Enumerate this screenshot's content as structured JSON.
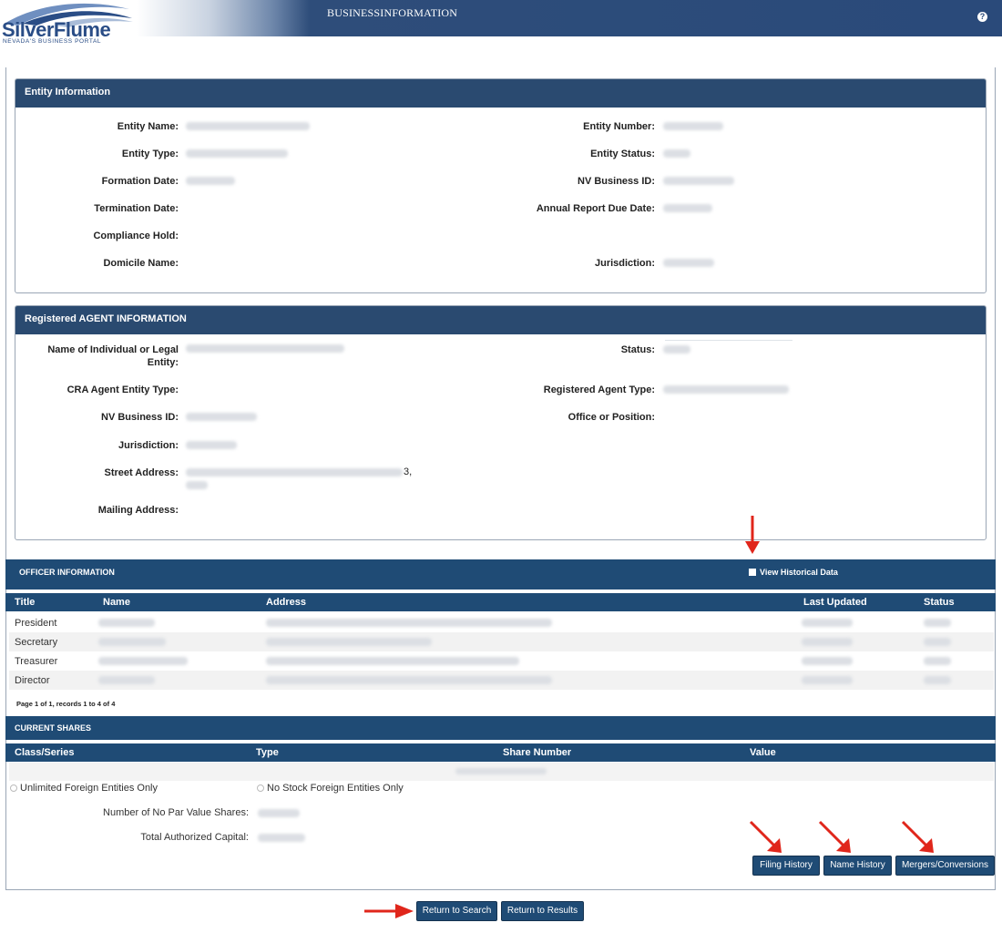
{
  "header": {
    "logo_name": "SilverFlume",
    "logo_tagline": "NEVADA'S BUSINESS PORTAL",
    "title": "BUSINESSINFORMATION",
    "help_icon": "question-circle-icon"
  },
  "entity": {
    "heading": "Entity Information",
    "labels": {
      "name": "Entity Name:",
      "type": "Entity Type:",
      "formation": "Formation Date:",
      "termination": "Termination Date:",
      "compliance": "Compliance Hold:",
      "domicile": "Domicile Name:",
      "number": "Entity Number:",
      "status": "Entity Status:",
      "nvid": "NV Business ID:",
      "annual": "Annual Report Due Date:",
      "jurisdiction": "Jurisdiction:"
    }
  },
  "agent": {
    "heading": "Registered AGENT INFORMATION",
    "labels": {
      "name_line1": "Name of Individual or Legal",
      "name_line2": "Entity:",
      "cra": "CRA Agent Entity Type:",
      "nvid": "NV Business ID:",
      "jurisdiction": "Jurisdiction:",
      "street": "Street Address:",
      "mailing": "Mailing Address:",
      "status": "Status:",
      "type": "Registered Agent Type:",
      "office": "Office or Position:"
    },
    "street_suffix": "3,"
  },
  "officers": {
    "heading": "OFFICER INFORMATION",
    "historical_label": "View Historical Data",
    "columns": [
      "Title",
      "Name",
      "Address",
      "Last Updated",
      "Status"
    ],
    "rows": [
      "President",
      "Secretary",
      "Treasurer",
      "Director"
    ],
    "pagination": "Page 1 of 1, records 1 to 4 of 4"
  },
  "shares": {
    "heading": "CURRENT SHARES",
    "columns": [
      "Class/Series",
      "Type",
      "Share Number",
      "Value"
    ],
    "radio_unlimited": "Unlimited Foreign Entities Only",
    "radio_nostock": "No Stock Foreign Entities Only",
    "no_par_label": "Number of No Par Value Shares:",
    "capital_label": "Total Authorized Capital:"
  },
  "buttons": {
    "filing_history": "Filing History",
    "name_history": "Name History",
    "mergers": "Mergers/Conversions",
    "return_search": "Return to Search",
    "return_results": "Return to Results"
  },
  "colors": {
    "header_blue": "#2a4a7a",
    "panel_blue": "#2a4a70",
    "bar_blue": "#1f4b75",
    "arrow_red": "#e0261b"
  }
}
